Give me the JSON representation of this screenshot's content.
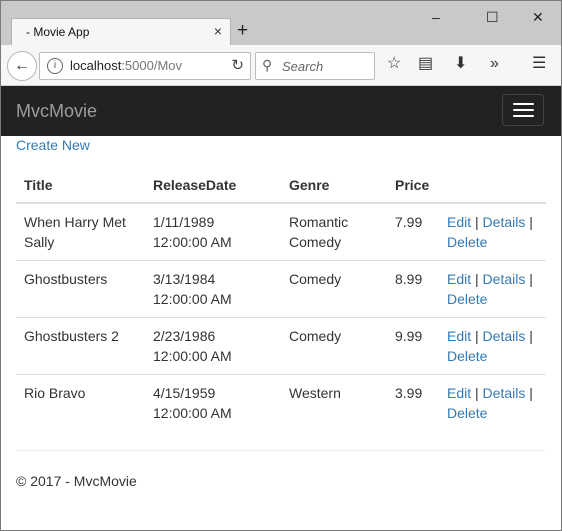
{
  "browser": {
    "tab_title": "- Movie App",
    "tab_close_glyph": "×",
    "newtab_glyph": "+",
    "url_host": "localhost",
    "url_rest": ":5000/Mov",
    "search_placeholder": "Search",
    "controls": {
      "minimize": "–",
      "maximize": "☐",
      "close": "✕"
    },
    "icons": [
      "back-arrow-icon",
      "info-icon",
      "reload-icon",
      "search-icon",
      "star-icon",
      "reader-icon",
      "download-icon",
      "overflow-icon",
      "menu-icon"
    ]
  },
  "app": {
    "brand": "MvcMovie",
    "create_new": "Create New",
    "columns": [
      "Title",
      "ReleaseDate",
      "Genre",
      "Price"
    ],
    "movies": [
      {
        "title": "When Harry Met Sally",
        "date": "1/11/1989",
        "time": "12:00:00 AM",
        "genre": "Romantic Comedy",
        "price": "7.99"
      },
      {
        "title": "Ghostbusters",
        "date": "3/13/1984",
        "time": "12:00:00 AM",
        "genre": "Comedy",
        "price": "8.99"
      },
      {
        "title": "Ghostbusters 2",
        "date": "2/23/1986",
        "time": "12:00:00 AM",
        "genre": "Comedy",
        "price": "9.99"
      },
      {
        "title": "Rio Bravo",
        "date": "4/15/1959",
        "time": "12:00:00 AM",
        "genre": "Western",
        "price": "3.99"
      }
    ],
    "actions": {
      "edit": "Edit",
      "details": "Details",
      "delete": "Delete",
      "sep": "|"
    },
    "footer": "© 2017 - MvcMovie"
  },
  "colors": {
    "navbar": "#222222",
    "brand": "#9d9d9d",
    "link": "#337ab7",
    "chrome": "#c9c9c9"
  }
}
